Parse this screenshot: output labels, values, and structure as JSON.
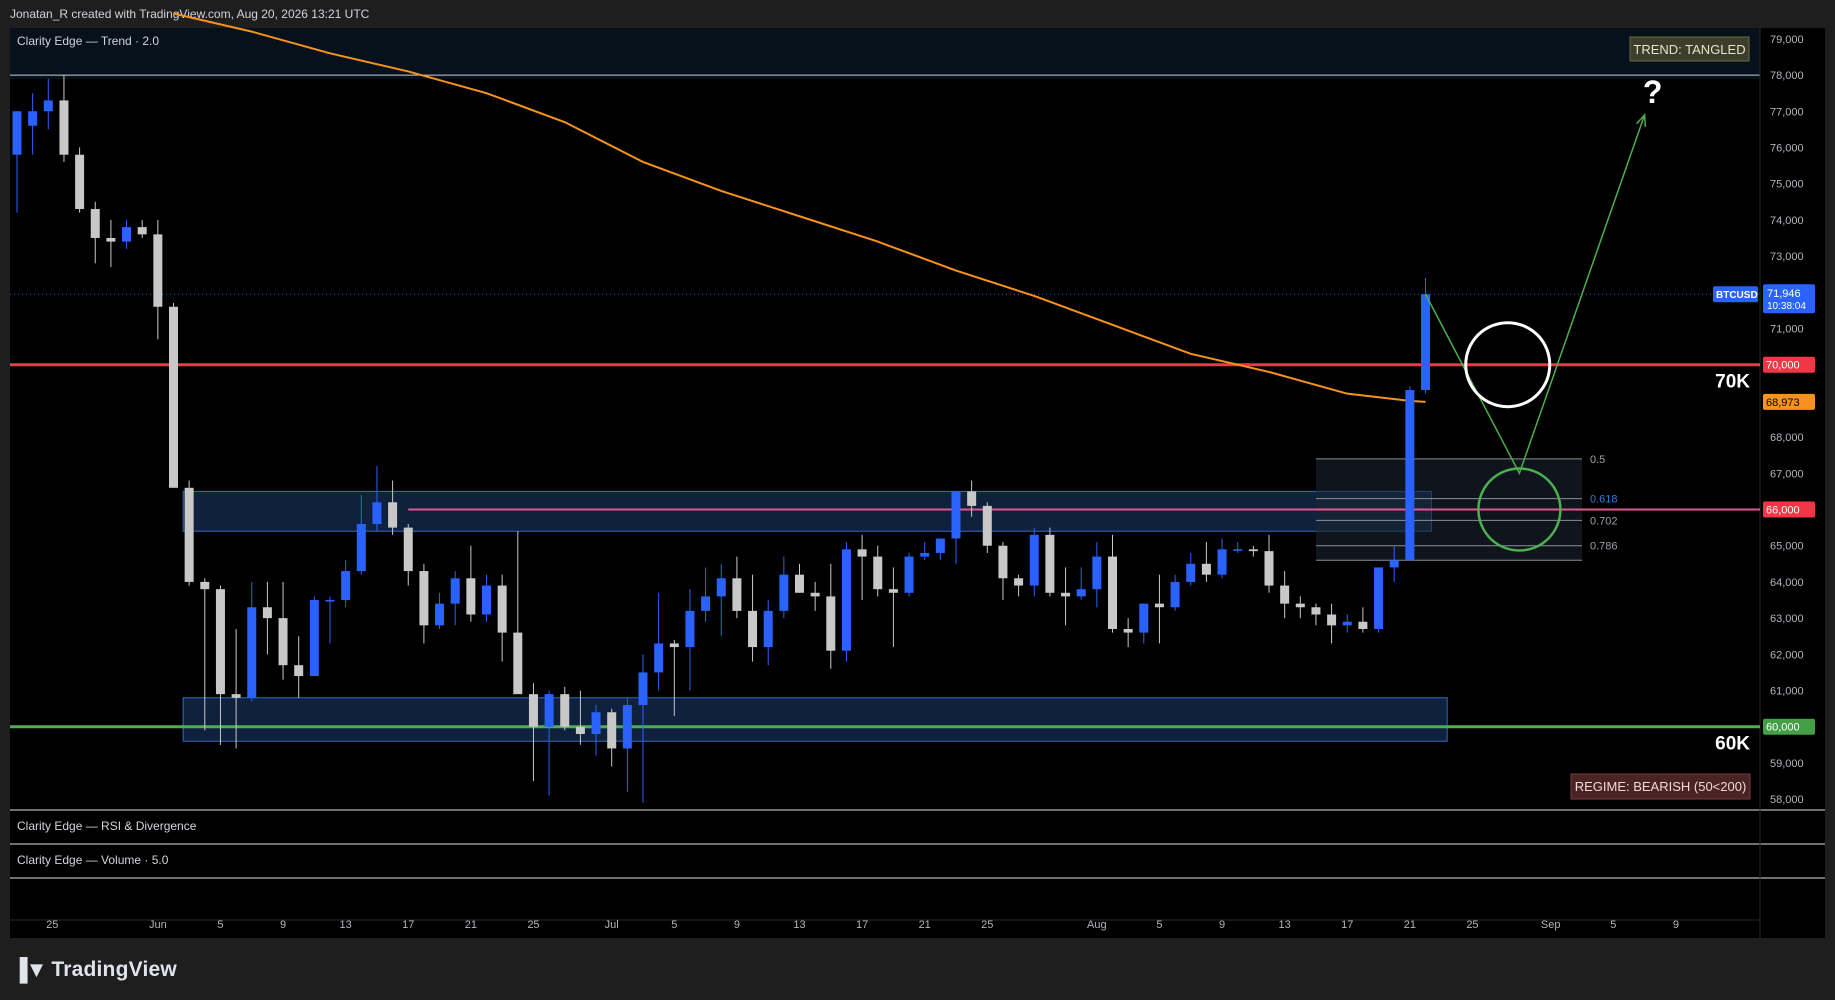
{
  "header": {
    "attribution": "Jonatan_R created with TradingView.com, Aug 20, 2026 13:21 UTC"
  },
  "panels": {
    "main_title": "Clarity Edge — Trend · 2.0",
    "rsi_title": "Clarity Edge — RSI & Divergence",
    "volume_title": "Clarity Edge — Volume · 5.0"
  },
  "badges": {
    "trend": "TREND: TANGLED",
    "regime": "REGIME: BEARISH (50<200)"
  },
  "annotations": {
    "level_70k": "70K",
    "level_60k": "60K",
    "question": "?",
    "fib": [
      "0.5",
      "0.618",
      "0.702",
      "0.786"
    ]
  },
  "price_scale": {
    "ticks": [
      "79,000",
      "78,000",
      "77,000",
      "76,000",
      "75,000",
      "74,000",
      "73,000",
      "72,000",
      "71,000",
      "70,000",
      "69,000",
      "68,000",
      "67,000",
      "66,000",
      "65,000",
      "64,000",
      "63,000",
      "62,000",
      "61,000",
      "60,000",
      "59,000",
      "58,000"
    ],
    "symbol": "BTCUSD",
    "last_price": "71,946",
    "countdown": "10:38:04",
    "tag_70000": "70,000",
    "tag_ma": "68,973",
    "tag_66000": "66,000",
    "tag_60000": "60,000"
  },
  "time_axis": {
    "labels": [
      "25",
      "Jun",
      "5",
      "9",
      "13",
      "17",
      "21",
      "25",
      "Jul",
      "5",
      "9",
      "13",
      "17",
      "21",
      "25",
      "Aug",
      "5",
      "9",
      "13",
      "17",
      "21",
      "25",
      "Sep",
      "5",
      "9"
    ]
  },
  "colors": {
    "up": "#2962ff",
    "down": "#c8c8c8",
    "ma": "#f7931a",
    "resistance": "#f23645",
    "support": "#4caf50",
    "mid_line": "#e0588f",
    "zone_fill": "#1c3d6e",
    "zone_border": "#2f6cc7"
  },
  "brand": {
    "logo_text": "TradingView"
  },
  "chart_data": {
    "type": "candlestick",
    "symbol": "BTCUSD",
    "ylim": [
      57700,
      79300
    ],
    "start_label": "May 23",
    "bar_interval": "1 day",
    "candles": [
      {
        "o": 75800,
        "h": 77000,
        "l": 74200,
        "c": 77000
      },
      {
        "o": 76600,
        "h": 77500,
        "l": 75800,
        "c": 77000
      },
      {
        "o": 77000,
        "h": 77900,
        "l": 76500,
        "c": 77300
      },
      {
        "o": 77300,
        "h": 78000,
        "l": 75600,
        "c": 75800
      },
      {
        "o": 75800,
        "h": 76000,
        "l": 74200,
        "c": 74300
      },
      {
        "o": 74300,
        "h": 74500,
        "l": 72800,
        "c": 73500
      },
      {
        "o": 73500,
        "h": 74000,
        "l": 72700,
        "c": 73400
      },
      {
        "o": 73400,
        "h": 74000,
        "l": 73200,
        "c": 73800
      },
      {
        "o": 73800,
        "h": 74000,
        "l": 73500,
        "c": 73600
      },
      {
        "o": 73600,
        "h": 74000,
        "l": 70700,
        "c": 71600
      },
      {
        "o": 71600,
        "h": 71700,
        "l": 66600,
        "c": 66600
      },
      {
        "o": 66600,
        "h": 66800,
        "l": 63900,
        "c": 64000
      },
      {
        "o": 64000,
        "h": 64100,
        "l": 59900,
        "c": 63800
      },
      {
        "o": 63800,
        "h": 63900,
        "l": 59500,
        "c": 60900
      },
      {
        "o": 60900,
        "h": 62700,
        "l": 59400,
        "c": 60800
      },
      {
        "o": 60800,
        "h": 64000,
        "l": 60700,
        "c": 63300
      },
      {
        "o": 63300,
        "h": 64000,
        "l": 62000,
        "c": 63000
      },
      {
        "o": 63000,
        "h": 64000,
        "l": 61300,
        "c": 61700
      },
      {
        "o": 61700,
        "h": 62500,
        "l": 60800,
        "c": 61400
      },
      {
        "o": 61400,
        "h": 63600,
        "l": 61400,
        "c": 63500
      },
      {
        "o": 63500,
        "h": 63600,
        "l": 62300,
        "c": 63500
      },
      {
        "o": 63500,
        "h": 64600,
        "l": 63300,
        "c": 64300
      },
      {
        "o": 64300,
        "h": 66400,
        "l": 64200,
        "c": 65600
      },
      {
        "o": 65600,
        "h": 67200,
        "l": 65400,
        "c": 66200
      },
      {
        "o": 66200,
        "h": 66800,
        "l": 65300,
        "c": 65500
      },
      {
        "o": 65500,
        "h": 65600,
        "l": 63900,
        "c": 64300
      },
      {
        "o": 64300,
        "h": 64500,
        "l": 62300,
        "c": 62800
      },
      {
        "o": 62800,
        "h": 63700,
        "l": 62700,
        "c": 63400
      },
      {
        "o": 63400,
        "h": 64300,
        "l": 62800,
        "c": 64100
      },
      {
        "o": 64100,
        "h": 65000,
        "l": 62900,
        "c": 63100
      },
      {
        "o": 63100,
        "h": 64200,
        "l": 62900,
        "c": 63900
      },
      {
        "o": 63900,
        "h": 64200,
        "l": 61800,
        "c": 62600
      },
      {
        "o": 62600,
        "h": 65400,
        "l": 61300,
        "c": 60900
      },
      {
        "o": 60900,
        "h": 61200,
        "l": 58500,
        "c": 60000
      },
      {
        "o": 60000,
        "h": 61000,
        "l": 58100,
        "c": 60900
      },
      {
        "o": 60900,
        "h": 61100,
        "l": 59900,
        "c": 60000
      },
      {
        "o": 60000,
        "h": 61000,
        "l": 59500,
        "c": 59800
      },
      {
        "o": 59800,
        "h": 60600,
        "l": 59200,
        "c": 60400
      },
      {
        "o": 60400,
        "h": 60500,
        "l": 58900,
        "c": 59400
      },
      {
        "o": 59400,
        "h": 60800,
        "l": 58200,
        "c": 60600
      },
      {
        "o": 60600,
        "h": 62000,
        "l": 57900,
        "c": 61500
      },
      {
        "o": 61500,
        "h": 63700,
        "l": 61000,
        "c": 62300
      },
      {
        "o": 62300,
        "h": 62400,
        "l": 60300,
        "c": 62200
      },
      {
        "o": 62200,
        "h": 63800,
        "l": 61000,
        "c": 63200
      },
      {
        "o": 63200,
        "h": 64400,
        "l": 62900,
        "c": 63600
      },
      {
        "o": 63600,
        "h": 64500,
        "l": 62500,
        "c": 64100
      },
      {
        "o": 64100,
        "h": 64700,
        "l": 63000,
        "c": 63200
      },
      {
        "o": 63200,
        "h": 64200,
        "l": 61800,
        "c": 62200
      },
      {
        "o": 62200,
        "h": 63500,
        "l": 61700,
        "c": 63200
      },
      {
        "o": 63200,
        "h": 64700,
        "l": 63000,
        "c": 64200
      },
      {
        "o": 64200,
        "h": 64500,
        "l": 63700,
        "c": 63700
      },
      {
        "o": 63700,
        "h": 64000,
        "l": 63200,
        "c": 63600
      },
      {
        "o": 63600,
        "h": 64500,
        "l": 61600,
        "c": 62100
      },
      {
        "o": 62100,
        "h": 65100,
        "l": 61800,
        "c": 64900
      },
      {
        "o": 64900,
        "h": 65300,
        "l": 63500,
        "c": 64700
      },
      {
        "o": 64700,
        "h": 65000,
        "l": 63600,
        "c": 63800
      },
      {
        "o": 63800,
        "h": 64400,
        "l": 62200,
        "c": 63700
      },
      {
        "o": 63700,
        "h": 64800,
        "l": 63600,
        "c": 64700
      },
      {
        "o": 64700,
        "h": 65100,
        "l": 64600,
        "c": 64800
      },
      {
        "o": 64800,
        "h": 65200,
        "l": 64600,
        "c": 65200
      },
      {
        "o": 65200,
        "h": 66300,
        "l": 64500,
        "c": 66500
      },
      {
        "o": 66500,
        "h": 66800,
        "l": 65800,
        "c": 66100
      },
      {
        "o": 66100,
        "h": 66200,
        "l": 64800,
        "c": 65000
      },
      {
        "o": 65000,
        "h": 65100,
        "l": 63500,
        "c": 64100
      },
      {
        "o": 64100,
        "h": 64200,
        "l": 63600,
        "c": 63900
      },
      {
        "o": 63900,
        "h": 65500,
        "l": 63600,
        "c": 65300
      },
      {
        "o": 65300,
        "h": 65500,
        "l": 63600,
        "c": 63700
      },
      {
        "o": 63700,
        "h": 64400,
        "l": 62800,
        "c": 63600
      },
      {
        "o": 63600,
        "h": 64400,
        "l": 63500,
        "c": 63800
      },
      {
        "o": 63800,
        "h": 65100,
        "l": 63300,
        "c": 64700
      },
      {
        "o": 64700,
        "h": 65300,
        "l": 62600,
        "c": 62700
      },
      {
        "o": 62700,
        "h": 63000,
        "l": 62200,
        "c": 62600
      },
      {
        "o": 62600,
        "h": 63400,
        "l": 62300,
        "c": 63400
      },
      {
        "o": 63400,
        "h": 64200,
        "l": 62300,
        "c": 63300
      },
      {
        "o": 63300,
        "h": 64200,
        "l": 63200,
        "c": 64000
      },
      {
        "o": 64000,
        "h": 64800,
        "l": 63900,
        "c": 64500
      },
      {
        "o": 64500,
        "h": 65100,
        "l": 64000,
        "c": 64200
      },
      {
        "o": 64200,
        "h": 65200,
        "l": 64100,
        "c": 64900
      },
      {
        "o": 64900,
        "h": 65100,
        "l": 64800,
        "c": 64900
      },
      {
        "o": 64900,
        "h": 65000,
        "l": 64700,
        "c": 64850
      },
      {
        "o": 64850,
        "h": 65300,
        "l": 63700,
        "c": 63900
      },
      {
        "o": 63900,
        "h": 64300,
        "l": 63000,
        "c": 63400
      },
      {
        "o": 63400,
        "h": 63600,
        "l": 63000,
        "c": 63300
      },
      {
        "o": 63300,
        "h": 63400,
        "l": 62800,
        "c": 63100
      },
      {
        "o": 63100,
        "h": 63400,
        "l": 62300,
        "c": 62800
      },
      {
        "o": 62800,
        "h": 63100,
        "l": 62600,
        "c": 62900
      },
      {
        "o": 62900,
        "h": 63300,
        "l": 62600,
        "c": 62700
      },
      {
        "o": 62700,
        "h": 64400,
        "l": 62600,
        "c": 64400
      },
      {
        "o": 64400,
        "h": 65000,
        "l": 64000,
        "c": 64600
      },
      {
        "o": 64600,
        "h": 69400,
        "l": 64600,
        "c": 69300
      },
      {
        "o": 69300,
        "h": 72400,
        "l": 69200,
        "c": 71946
      }
    ],
    "moving_average": {
      "points": [
        {
          "i": 10,
          "v": 79700
        },
        {
          "i": 15,
          "v": 79200
        },
        {
          "i": 20,
          "v": 78600
        },
        {
          "i": 25,
          "v": 78100
        },
        {
          "i": 30,
          "v": 77500
        },
        {
          "i": 35,
          "v": 76700
        },
        {
          "i": 40,
          "v": 75600
        },
        {
          "i": 45,
          "v": 74800
        },
        {
          "i": 50,
          "v": 74100
        },
        {
          "i": 55,
          "v": 73400
        },
        {
          "i": 60,
          "v": 72600
        },
        {
          "i": 65,
          "v": 71900
        },
        {
          "i": 70,
          "v": 71100
        },
        {
          "i": 75,
          "v": 70300
        },
        {
          "i": 80,
          "v": 69800
        },
        {
          "i": 85,
          "v": 69200
        },
        {
          "i": 89,
          "v": 69000
        },
        {
          "i": 90,
          "v": 68973
        }
      ]
    },
    "levels": {
      "resistance": 70000,
      "support": 60000,
      "mid": 66000,
      "box_top": 78000
    },
    "zones": [
      {
        "from_i": 11,
        "to_i": 90,
        "top": 66500,
        "bottom": 65400
      },
      {
        "from_i": 11,
        "to_i": 91,
        "top": 60800,
        "bottom": 59600
      }
    ],
    "fib": {
      "from_i": 83,
      "to_i": 100,
      "levels": [
        {
          "r": "0.5",
          "v": 67400
        },
        {
          "r": "0.618",
          "v": 66300
        },
        {
          "r": "0.702",
          "v": 65700
        },
        {
          "r": "0.786",
          "v": 65000
        }
      ],
      "bottom": 64600
    },
    "projection": {
      "path": [
        {
          "i": 90,
          "v": 71950
        },
        {
          "i": 96,
          "v": 67000
        },
        {
          "i": 104,
          "v": 76900
        }
      ],
      "white_circle": {
        "i": 95,
        "v": 70000
      },
      "green_circle": {
        "i": 96,
        "v": 66000
      }
    }
  }
}
